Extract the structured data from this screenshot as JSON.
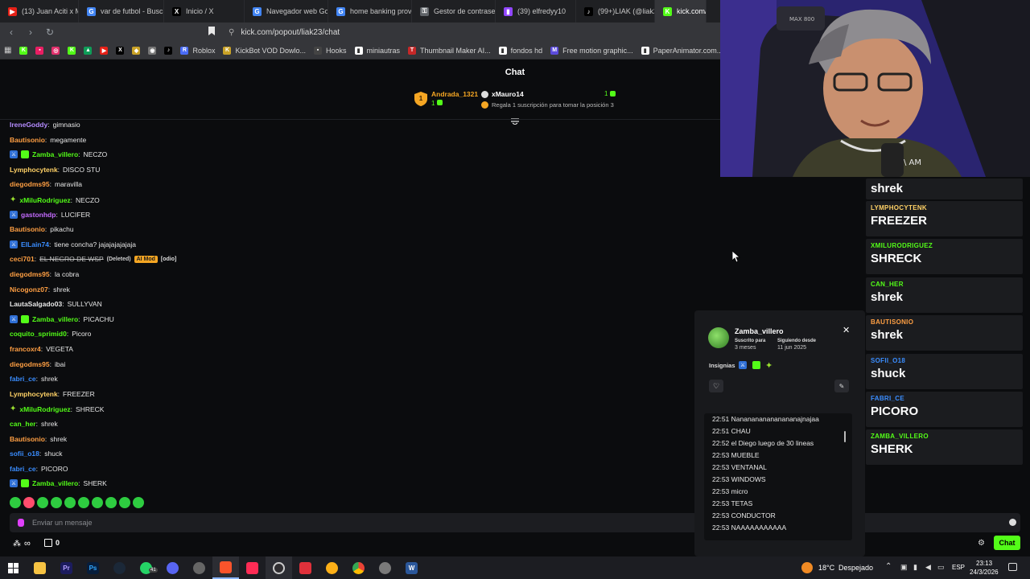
{
  "browser": {
    "tabs": [
      {
        "label": "(13) Juan Aciti x Ma",
        "color": "#e62117",
        "glyph": "▶"
      },
      {
        "label": "var de futbol - Busc",
        "color": "#4285f4",
        "glyph": "G"
      },
      {
        "label": "Inicio / X",
        "color": "#000000",
        "glyph": "X"
      },
      {
        "label": "Navegador web Go",
        "color": "#4285f4",
        "glyph": "G"
      },
      {
        "label": "home banking prov",
        "color": "#4285f4",
        "glyph": "G"
      },
      {
        "label": "Gestor de contrasei",
        "color": "#5f6368",
        "glyph": "⚿"
      },
      {
        "label": "(39) elfredyy10",
        "color": "#9146ff",
        "glyph": "▮"
      },
      {
        "label": "(99+)LIAK (@liak23",
        "color": "#000000",
        "glyph": "♪"
      },
      {
        "label": "kick.com/po",
        "color": "#53fc18",
        "glyph": "K"
      }
    ],
    "url": "kick.com/popout/liak23/chat",
    "bookmarks": [
      {
        "label": "",
        "color": "#53fc18",
        "glyph": "K"
      },
      {
        "label": "",
        "color": "#e91e63",
        "glyph": "▪"
      },
      {
        "label": "",
        "color": "#e1306c",
        "glyph": "◎"
      },
      {
        "label": "",
        "color": "#53fc18",
        "glyph": "K"
      },
      {
        "label": "",
        "color": "#0f9d58",
        "glyph": "▲"
      },
      {
        "label": "",
        "color": "#e62117",
        "glyph": "▶"
      },
      {
        "label": "",
        "color": "#000000",
        "glyph": "X"
      },
      {
        "label": "",
        "color": "#c9a227",
        "glyph": "◆"
      },
      {
        "label": "",
        "color": "#777777",
        "glyph": "◉"
      },
      {
        "label": "",
        "color": "#000000",
        "glyph": "♪"
      },
      {
        "label": "Roblox",
        "color": "#4a6cf7",
        "glyph": "R"
      },
      {
        "label": "KickBot VOD Dowlo...",
        "color": "#c9a227",
        "glyph": "K"
      },
      {
        "label": "Hooks",
        "color": "#444444",
        "glyph": "▪"
      },
      {
        "label": "miniautras",
        "color": "#ffffff",
        "glyph": "▮"
      },
      {
        "label": "Thumbnail Maker AI...",
        "color": "#c62828",
        "glyph": "T"
      },
      {
        "label": "fondos hd",
        "color": "#ffffff",
        "glyph": "▮"
      },
      {
        "label": "Free motion graphic...",
        "color": "#5b4bdb",
        "glyph": "M"
      },
      {
        "label": "PaperAnimator.com...",
        "color": "#ffffff",
        "glyph": "▮"
      }
    ]
  },
  "chat": {
    "title": "Chat",
    "leaderboard": {
      "rank": "1",
      "first_name": "Andrada_1321",
      "first_count": "1",
      "second_name": "xMauro14",
      "second_count": "1",
      "gift_text": "Regala 1 suscripción para tomar la posición 3"
    },
    "messages": [
      {
        "user": "IreneGoddy",
        "text": "gimnasio",
        "color": "#b58cff",
        "badges": []
      },
      {
        "user": "Bautisonio",
        "text": "megamente",
        "color": "#ff9f43",
        "badges": []
      },
      {
        "user": "Zamba_villero",
        "text": "NECZO",
        "color": "#53fc18",
        "badges": [
          "mod",
          "sub"
        ]
      },
      {
        "user": "Lymphocytenk",
        "text": "DISCO STU",
        "color": "#ffd166",
        "badges": []
      },
      {
        "user": "diegodms95",
        "text": "maravilla",
        "color": "#ff9f43",
        "badges": []
      },
      {
        "user": "xMiluRodriguez",
        "text": "NECZO",
        "color": "#53fc18",
        "badges": [
          "star"
        ]
      },
      {
        "user": "gastonhdp",
        "text": "LUCIFER",
        "color": "#c46bff",
        "badges": [
          "mod"
        ]
      },
      {
        "user": "Bautisonio",
        "text": "pikachu",
        "color": "#ff9f43",
        "badges": []
      },
      {
        "user": "ElLain74",
        "text": "tiene concha? jajajajajajaja",
        "color": "#3a8dff",
        "badges": [
          "mod"
        ]
      },
      {
        "user": "ceci701",
        "text": "EL NEGRO DE WSP",
        "color": "#ff9f43",
        "badges": [],
        "deleted": true,
        "deleted_label": "(Deleted)",
        "tag": "AI Mod",
        "tag_suffix": "[odio]"
      },
      {
        "user": "diegodms95",
        "text": "la cobra",
        "color": "#ff9f43",
        "badges": []
      },
      {
        "user": "Nicogonz07",
        "text": "shrek",
        "color": "#ff9f43",
        "badges": []
      },
      {
        "user": "LautaSalgado03",
        "text": "SULLYVAN",
        "color": "#e8e8e8",
        "badges": []
      },
      {
        "user": "Zamba_villero",
        "text": "PICACHU",
        "color": "#53fc18",
        "badges": [
          "mod",
          "sub"
        ]
      },
      {
        "user": "coquito_sprimid0",
        "text": "Picoro",
        "color": "#53fc18",
        "badges": []
      },
      {
        "user": "francoxr4",
        "text": "VEGETA",
        "color": "#ff9f43",
        "badges": []
      },
      {
        "user": "diegodms95",
        "text": "ibai",
        "color": "#ff9f43",
        "badges": []
      },
      {
        "user": "fabri_ce",
        "text": "shrek",
        "color": "#3a8dff",
        "badges": []
      },
      {
        "user": "Lymphocytenk",
        "text": "FREEZER",
        "color": "#ffd166",
        "badges": []
      },
      {
        "user": "xMiluRodriguez",
        "text": "SHRECK",
        "color": "#53fc18",
        "badges": [
          "star"
        ]
      },
      {
        "user": "can_her",
        "text": "shrek",
        "color": "#53fc18",
        "badges": []
      },
      {
        "user": "Bautisonio",
        "text": "shrek",
        "color": "#ff9f43",
        "badges": []
      },
      {
        "user": "sofii_o18",
        "text": "shuck",
        "color": "#3a8dff",
        "badges": []
      },
      {
        "user": "fabri_ce",
        "text": "PICORO",
        "color": "#3a8dff",
        "badges": []
      },
      {
        "user": "Zamba_villero",
        "text": "SHERK",
        "color": "#53fc18",
        "badges": [
          "mod",
          "sub"
        ]
      }
    ],
    "input_placeholder": "Enviar un mensaje",
    "bottom": {
      "viewers": "∞",
      "gifts": "0",
      "chat_button": "Chat"
    }
  },
  "overlay": {
    "items": [
      {
        "user": "",
        "text": "shrek",
        "color": "#53fc18"
      },
      {
        "user": "LYMPHOCYTENK",
        "text": "FREEZER",
        "color": "#ffd166"
      },
      {
        "user": "XMILURODRIGUEZ",
        "text": "SHRECK",
        "color": "#53fc18"
      },
      {
        "user": "CAN_HER",
        "text": "shrek",
        "color": "#53fc18"
      },
      {
        "user": "BAUTISONIO",
        "text": "shrek",
        "color": "#ff9f43"
      },
      {
        "user": "SOFII_O18",
        "text": "shuck",
        "color": "#3a8dff"
      },
      {
        "user": "FABRI_CE",
        "text": "PICORO",
        "color": "#3a8dff"
      },
      {
        "user": "ZAMBA_VILLERO",
        "text": "SHERK",
        "color": "#53fc18"
      }
    ]
  },
  "usercard": {
    "name": "Zamba_villero",
    "sub_label": "Suscrito para",
    "sub_value": "3 meses",
    "follow_label": "Siguiendo desde",
    "follow_value": "11 jun 2025",
    "badges_label": "Insignias",
    "history": [
      "22:51 Nananananananananajnajaa",
      "22:51 CHAU",
      "22:52 el Diego luego de 30 lineas",
      "22:53 MUEBLE",
      "22:53 VENTANAL",
      "22:53 WINDOWS",
      "22:53 micro",
      "22:53 TETAS",
      "22:53 CONDUCTOR",
      "22:53 NAAAAAAAAAAA"
    ]
  },
  "taskbar": {
    "weather_temp": "18°C",
    "weather_text": "Despejado",
    "lang": "ESP",
    "time": "23:13",
    "date": "24/3/2026",
    "whatsapp_badge": "41"
  }
}
